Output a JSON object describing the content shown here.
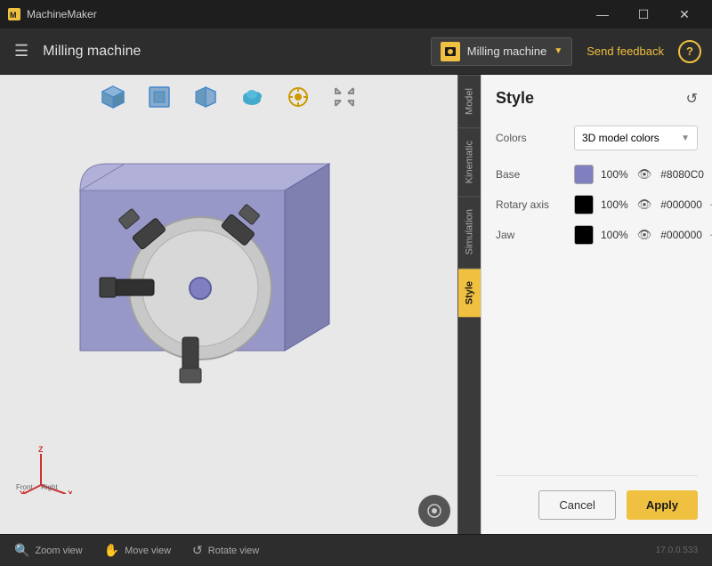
{
  "titlebar": {
    "app_name": "MachineMaker",
    "min_btn": "—",
    "max_btn": "☐",
    "close_btn": "✕"
  },
  "toolbar": {
    "hamburger": "☰",
    "title": "Milling machine",
    "machine_name": "Milling machine",
    "feedback_label": "Send feedback",
    "help_label": "?"
  },
  "viewport_tools": [
    {
      "name": "perspective-cube-icon",
      "symbol": "⬡"
    },
    {
      "name": "front-view-icon",
      "symbol": "⬡"
    },
    {
      "name": "side-view-icon",
      "symbol": "⬡"
    },
    {
      "name": "explode-icon",
      "symbol": "☁"
    },
    {
      "name": "measure-icon",
      "symbol": "⊙"
    },
    {
      "name": "fit-view-icon",
      "symbol": "⤢"
    }
  ],
  "side_tabs": [
    {
      "label": "Model",
      "active": false
    },
    {
      "label": "Kinematic",
      "active": false
    },
    {
      "label": "Simulation",
      "active": false
    },
    {
      "label": "Style",
      "active": true
    }
  ],
  "style_panel": {
    "title": "Style",
    "reset_icon": "↺",
    "colors_label": "Colors",
    "colors_select": "3D model colors",
    "rows": [
      {
        "label": "Base",
        "color": "#8080C0",
        "opacity": "100%",
        "hex": "#8080C0",
        "swatch_style": "background:#8080C0"
      },
      {
        "label": "Rotary axis",
        "color": "#000000",
        "opacity": "100%",
        "hex": "#000000",
        "swatch_style": "background:#000000"
      },
      {
        "label": "Jaw",
        "color": "#000000",
        "opacity": "100%",
        "hex": "#000000",
        "swatch_style": "background:#000000"
      }
    ]
  },
  "actions": {
    "cancel_label": "Cancel",
    "apply_label": "Apply"
  },
  "bottom_bar": {
    "tools": [
      {
        "label": "Zoom view",
        "icon": "🔍"
      },
      {
        "label": "Move view",
        "icon": "✋"
      },
      {
        "label": "Rotate view",
        "icon": "↺"
      }
    ],
    "version": "17.0.0.533"
  },
  "axis": {
    "x": "X",
    "y": "Y",
    "z": "Z",
    "front": "Front",
    "right": "Right"
  }
}
